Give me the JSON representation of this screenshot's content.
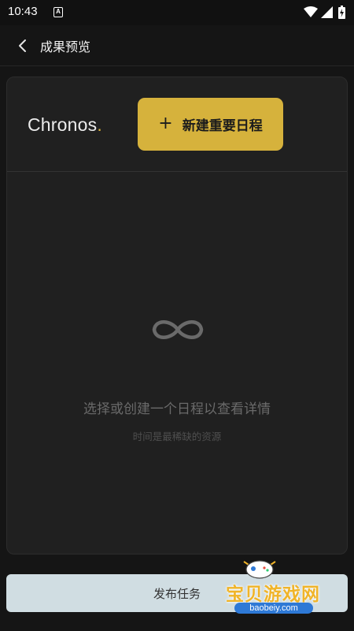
{
  "status_bar": {
    "time": "10:43",
    "notification_glyph": "A",
    "icons": [
      "wifi-icon",
      "signal-icon",
      "battery-charging-icon"
    ]
  },
  "app_bar": {
    "back_icon": "chevron-left-icon",
    "title": "成果预览"
  },
  "card": {
    "brand": "Chronos",
    "brand_dot": ".",
    "new_button": {
      "icon": "plus-icon",
      "plus_glyph": "+",
      "label": "新建重要日程"
    },
    "empty_state": {
      "icon": "infinity-icon",
      "title": "选择或创建一个日程以查看详情",
      "subtitle": "时间是最稀缺的资源"
    }
  },
  "footer": {
    "publish_label": "发布任务"
  },
  "watermark": {
    "text": "宝贝游戏网",
    "url": "baobeiy.com"
  },
  "colors": {
    "background": "#151515",
    "card": "#202020",
    "accent": "#d6b23c",
    "publish_button": "#d0dde2",
    "muted_text": "#6a6a6a"
  }
}
